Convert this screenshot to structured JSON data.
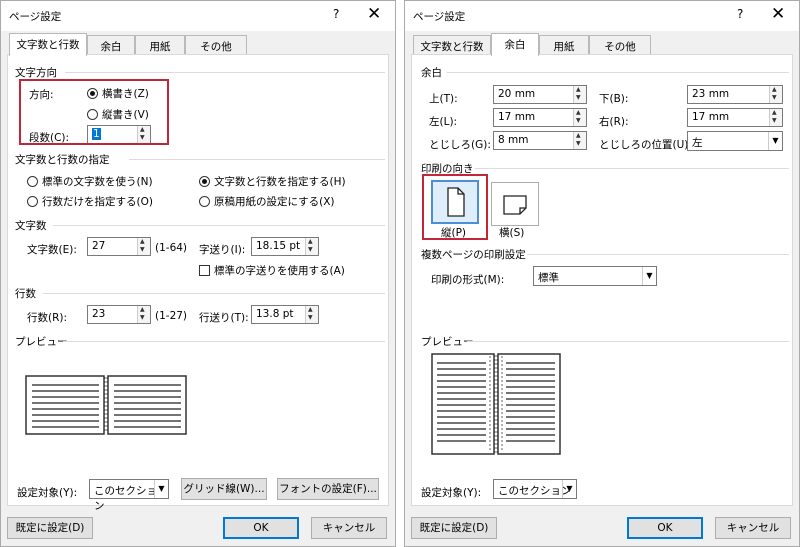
{
  "left": {
    "title": "ページ設定",
    "help": "?",
    "close": "✕",
    "tabs": [
      "文字数と行数",
      "余白",
      "用紙",
      "その他"
    ],
    "direction_section": "文字方向",
    "direction_label": "方向:",
    "horizontal": "横書き(Z)",
    "vertical": "縦書き(V)",
    "columns_label": "段数(C):",
    "columns_value": "1",
    "spec_section": "文字数と行数の指定",
    "opt_standard": "標準の文字数を使う(N)",
    "opt_chars_lines": "文字数と行数を指定する(H)",
    "opt_lines_only": "行数だけを指定する(O)",
    "opt_manuscript": "原稿用紙の設定にする(X)",
    "chars_section": "文字数",
    "chars_label": "文字数(E):",
    "chars_value": "27",
    "chars_range": "(1-64)",
    "pitch_label": "字送り(I):",
    "pitch_value": "18.15 pt",
    "use_standard_pitch": "標準の字送りを使用する(A)",
    "lines_section": "行数",
    "lines_label": "行数(R):",
    "lines_value": "23",
    "lines_range": "(1-27)",
    "line_pitch_label": "行送り(T):",
    "line_pitch_value": "13.8 pt",
    "preview_section": "プレビュー",
    "apply_label": "設定対象(Y):",
    "apply_value": "このセクション",
    "grid_button": "グリッド線(W)...",
    "font_button": "フォントの設定(F)...",
    "default_button": "既定に設定(D)",
    "ok": "OK",
    "cancel": "キャンセル"
  },
  "right": {
    "title": "ページ設定",
    "help": "?",
    "close": "✕",
    "tabs": [
      "文字数と行数",
      "余白",
      "用紙",
      "その他"
    ],
    "margin_section": "余白",
    "top_label": "上(T):",
    "top_value": "20 mm",
    "bottom_label": "下(B):",
    "bottom_value": "23 mm",
    "left_label": "左(L):",
    "left_value": "17 mm",
    "right_label": "右(R):",
    "right_value": "17 mm",
    "gutter_label": "とじしろ(G):",
    "gutter_value": "8 mm",
    "gutter_pos_label": "とじしろの位置(U):",
    "gutter_pos_value": "左",
    "orientation_section": "印刷の向き",
    "portrait": "縦(P)",
    "landscape": "横(S)",
    "multipage_section": "複数ページの印刷設定",
    "print_format_label": "印刷の形式(M):",
    "print_format_value": "標準",
    "preview_section": "プレビュー",
    "apply_label": "設定対象(Y):",
    "apply_value": "このセクション",
    "default_button": "既定に設定(D)",
    "ok": "OK",
    "cancel": "キャンセル"
  }
}
